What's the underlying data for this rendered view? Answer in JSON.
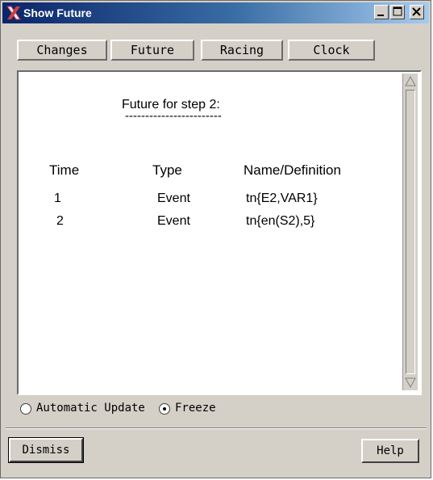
{
  "window": {
    "title": "Show Future",
    "app_icon": "x-logo-icon",
    "controls": [
      "minimize-icon",
      "maximize-icon",
      "close-icon"
    ]
  },
  "tabs": [
    {
      "label": "Changes"
    },
    {
      "label": "Future"
    },
    {
      "label": "Racing"
    },
    {
      "label": "Clock"
    }
  ],
  "panel": {
    "heading": "Future for step 2:",
    "underline": "------------------------",
    "columns": [
      "Time",
      "Type",
      "Name/Definition"
    ],
    "rows": [
      {
        "time": "1",
        "type": "Event",
        "definition": "tn{E2,VAR1}"
      },
      {
        "time": "2",
        "type": "Event",
        "definition": "tn{en(S2),5}"
      }
    ]
  },
  "update_mode": {
    "options": [
      {
        "label": "Automatic Update",
        "selected": false
      },
      {
        "label": "Freeze",
        "selected": true
      }
    ]
  },
  "buttons": {
    "dismiss": "Dismiss",
    "help": "Help"
  },
  "colors": {
    "title_bar_start": "#0a246a",
    "title_bar_end": "#a6caf0",
    "window_bg": "#d4d0c8",
    "panel_bg": "#ffffff"
  }
}
